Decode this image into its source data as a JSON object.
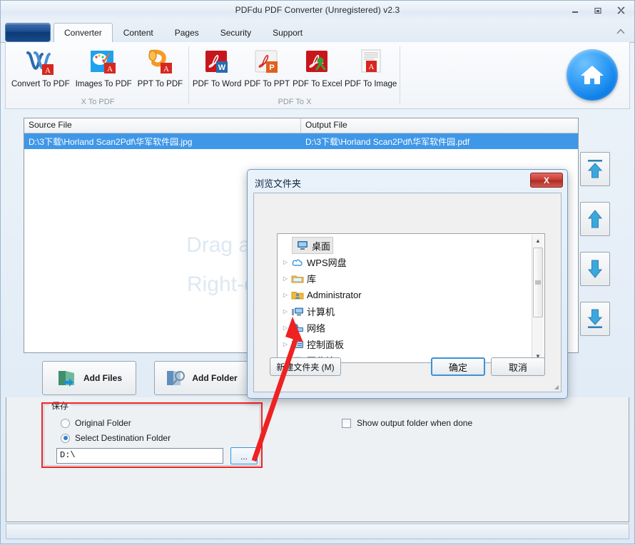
{
  "window": {
    "title": "PDFdu PDF Converter (Unregistered) v2.3",
    "minimize": "–",
    "maximize": "❐",
    "close": "✕"
  },
  "tabs": [
    {
      "label": "Converter",
      "active": true
    },
    {
      "label": "Content",
      "active": false
    },
    {
      "label": "Pages",
      "active": false
    },
    {
      "label": "Security",
      "active": false
    },
    {
      "label": "Support",
      "active": false
    }
  ],
  "ribbon": {
    "groups": [
      {
        "label": "X To PDF",
        "commands": [
          {
            "label": "Convert To PDF",
            "icon": "word-to-pdf-icon"
          },
          {
            "label": "Images To PDF",
            "icon": "images-to-pdf-icon"
          },
          {
            "label": "PPT To PDF",
            "icon": "ppt-to-pdf-icon"
          }
        ]
      },
      {
        "label": "PDF To X",
        "commands": [
          {
            "label": "PDF To Word",
            "icon": "pdf-to-word-icon"
          },
          {
            "label": "PDF To PPT",
            "icon": "pdf-to-ppt-icon"
          },
          {
            "label": "PDF To Excel",
            "icon": "pdf-to-excel-icon"
          },
          {
            "label": "PDF To Image",
            "icon": "pdf-to-image-icon"
          }
        ]
      }
    ],
    "collapse_icon": "chevron-up-icon"
  },
  "file_list": {
    "columns": [
      "Source File",
      "Output File"
    ],
    "rows": [
      {
        "source": "D:\\3下载\\Horland Scan2Pdf\\华军软件园.jpg",
        "output": "D:\\3下载\\Horland Scan2Pdf\\华军软件园.pdf"
      }
    ],
    "watermark_line1": "Drag and drop files here",
    "watermark_line2": "Right-click Remove files"
  },
  "order_buttons": [
    {
      "name": "move-to-top",
      "icon": "arrow-up-to-line-icon"
    },
    {
      "name": "move-up",
      "icon": "arrow-up-icon"
    },
    {
      "name": "move-down",
      "icon": "arrow-down-icon"
    },
    {
      "name": "move-to-bottom",
      "icon": "arrow-down-to-line-icon"
    }
  ],
  "actions": {
    "add_files": "Add Files",
    "add_folder": "Add Folder"
  },
  "save_group": {
    "title": "保存",
    "original_folder": "Original Folder",
    "select_destination": "Select Destination Folder",
    "selected": "select_destination",
    "path_value": "D:\\",
    "browse_button": "...",
    "highlight_color": "#ee2222"
  },
  "options": {
    "show_output_folder": "Show output folder when done",
    "show_output_folder_checked": false
  },
  "dialog": {
    "title": "浏览文件夹",
    "close_label": "X",
    "tree": [
      {
        "label": "桌面",
        "icon": "desktop-icon",
        "expandable": false,
        "selected": true,
        "indent": 0
      },
      {
        "label": "WPS网盘",
        "icon": "cloud-icon",
        "expandable": true,
        "selected": false,
        "indent": 1
      },
      {
        "label": "库",
        "icon": "library-folder-icon",
        "expandable": true,
        "selected": false,
        "indent": 1
      },
      {
        "label": "Administrator",
        "icon": "user-folder-icon",
        "expandable": true,
        "selected": false,
        "indent": 1
      },
      {
        "label": "计算机",
        "icon": "computer-icon",
        "expandable": true,
        "selected": false,
        "indent": 1
      },
      {
        "label": "网络",
        "icon": "network-icon",
        "expandable": true,
        "selected": false,
        "indent": 1
      },
      {
        "label": "控制面板",
        "icon": "control-panel-icon",
        "expandable": true,
        "selected": false,
        "indent": 1
      },
      {
        "label": "回收站",
        "icon": "recycle-bin-icon",
        "expandable": false,
        "selected": false,
        "indent": 1
      }
    ],
    "new_folder_button": "新建文件夹 (M)",
    "ok_button": "确定",
    "cancel_button": "取消"
  },
  "annotation": {
    "color": "#ee2222",
    "type": "arrow-pointing-from-browse-button-to-network-tree-item"
  }
}
